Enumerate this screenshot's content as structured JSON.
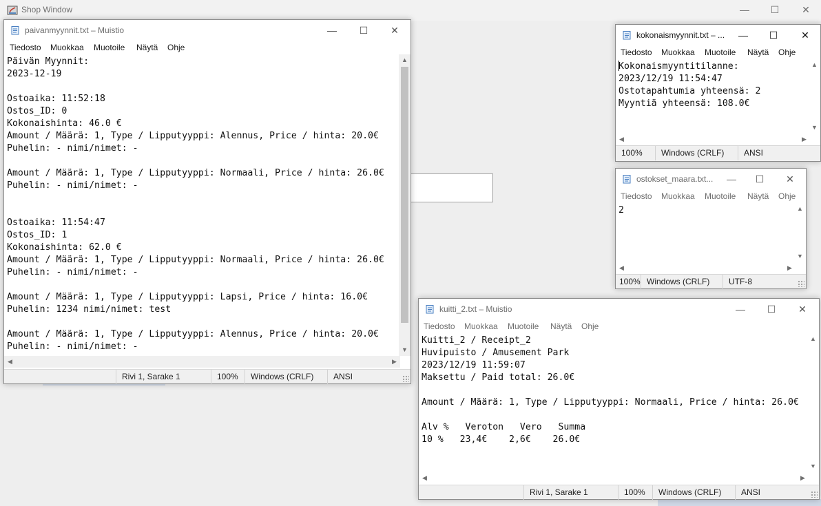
{
  "background_app": {
    "title": "Shop Window",
    "controls": {
      "minimize": "—",
      "maximize": "☐",
      "close": "✕"
    }
  },
  "window_controls": {
    "minimize": "—",
    "maximize": "☐",
    "close": "✕"
  },
  "menu": [
    "Tiedosto",
    "Muokkaa",
    "Muotoile",
    "Näytä",
    "Ohje"
  ],
  "windows": {
    "paivan": {
      "title": "paivanmyynnit.txt – Muistio",
      "content": "Päivän Myynnit:\n2023-12-19\n\nOstoaika: 11:52:18\nOstos_ID: 0\nKokonaishinta: 46.0 €\nAmount / Määrä: 1, Type / Lipputyyppi: Alennus, Price / hinta: 20.0€\nPuhelin: - nimi/nimet: -\n\nAmount / Määrä: 1, Type / Lipputyyppi: Normaali, Price / hinta: 26.0€\nPuhelin: - nimi/nimet: -\n\n\nOstoaika: 11:54:47\nOstos_ID: 1\nKokonaishinta: 62.0 €\nAmount / Määrä: 1, Type / Lipputyyppi: Normaali, Price / hinta: 26.0€\nPuhelin: - nimi/nimet: -\n\nAmount / Määrä: 1, Type / Lipputyyppi: Lapsi, Price / hinta: 16.0€\nPuhelin: 1234 nimi/nimet: test\n\nAmount / Määrä: 1, Type / Lipputyyppi: Alennus, Price / hinta: 20.0€\nPuhelin: - nimi/nimet: -",
      "status": {
        "position": "Rivi 1, Sarake 1",
        "zoom": "100%",
        "line_ending": "Windows (CRLF)",
        "encoding": "ANSI"
      }
    },
    "kokonais": {
      "title": "kokonaismyynnit.txt – ...",
      "content_first_char": "K",
      "content_rest": "okonaismyyntitilanne:\n2023/12/19 11:54:47\nOstotapahtumia yhteensä: 2\nMyyntiä yhteensä: 108.0€",
      "status": {
        "zoom": "100%",
        "line_ending": "Windows (CRLF)",
        "encoding": "ANSI"
      }
    },
    "ostokset": {
      "title": "ostokset_maara.txt...",
      "content": "2",
      "status": {
        "zoom": "100%",
        "line_ending": "Windows (CRLF)",
        "encoding": "UTF-8"
      }
    },
    "kuitti": {
      "title": "kuitti_2.txt – Muistio",
      "content": "Kuitti_2 / Receipt_2\nHuvipuisto / Amusement Park\n2023/12/19 11:59:07\nMaksettu / Paid total: 26.0€\n\nAmount / Määrä: 1, Type / Lipputyyppi: Normaali, Price / hinta: 26.0€\n\nAlv %   Veroton   Vero   Summa\n10 %   23,4€    2,6€    26.0€",
      "status": {
        "position": "Rivi 1, Sarake 1",
        "zoom": "100%",
        "line_ending": "Windows (CRLF)",
        "encoding": "ANSI"
      }
    }
  },
  "scroll_arrows": {
    "up": "▲",
    "down": "▼",
    "left": "◀",
    "right": "▶"
  }
}
